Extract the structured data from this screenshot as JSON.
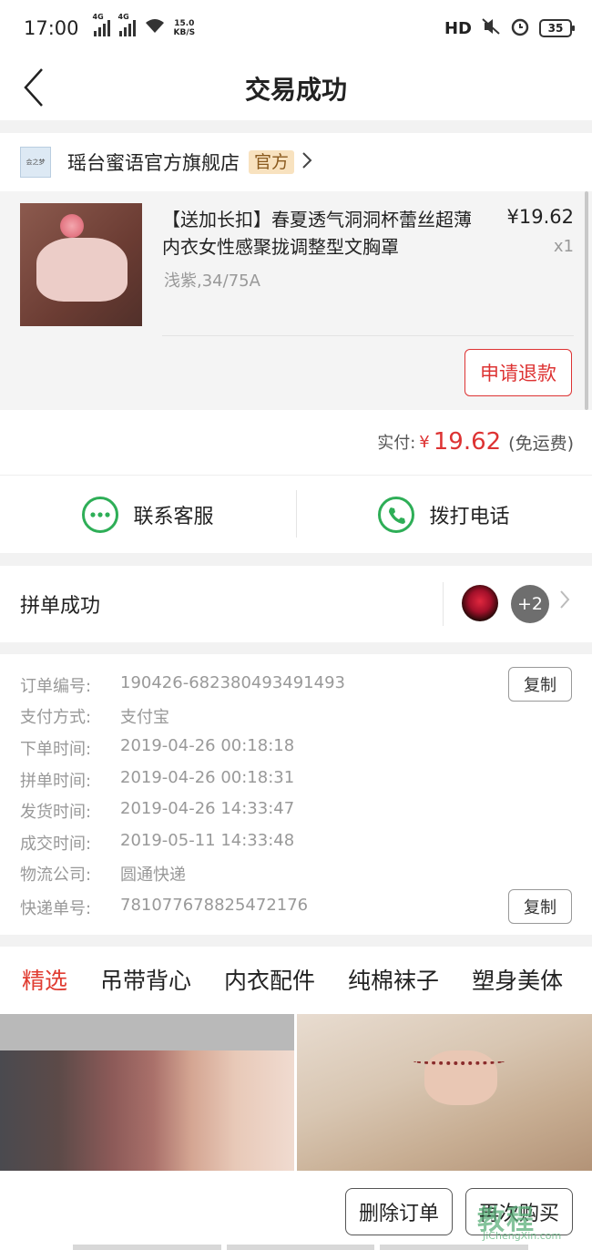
{
  "status_bar": {
    "time": "17:00",
    "net1": "4G",
    "net2": "4G",
    "speed_value": "15.0",
    "speed_unit": "KB/S",
    "hd": "HD",
    "battery": "35"
  },
  "nav": {
    "title": "交易成功"
  },
  "store": {
    "name": "瑶台蜜语官方旗舰店",
    "tag": "官方",
    "logo_text": "会之梦"
  },
  "product": {
    "title": "【送加长扣】春夏透气洞洞杯蕾丝超薄内衣女性感聚拢调整型文胸罩",
    "spec": "浅紫,34/75A",
    "price": "¥19.62",
    "qty": "x1",
    "refund_label": "申请退款"
  },
  "payment": {
    "label": "实付:",
    "yen": "¥",
    "amount": "19.62",
    "note": "(免运费)"
  },
  "contact": {
    "service_label": "联系客服",
    "phone_label": "拨打电话"
  },
  "group": {
    "label": "拼单成功",
    "more_count": "+2"
  },
  "order_info": {
    "copy_label": "复制",
    "rows": [
      {
        "k": "订单编号:",
        "v": "190426-682380493491493"
      },
      {
        "k": "支付方式:",
        "v": "支付宝"
      },
      {
        "k": "下单时间:",
        "v": "2019-04-26 00:18:18"
      },
      {
        "k": "拼单时间:",
        "v": "2019-04-26 00:18:31"
      },
      {
        "k": "发货时间:",
        "v": "2019-04-26 14:33:47"
      },
      {
        "k": "成交时间:",
        "v": "2019-05-11 14:33:48"
      },
      {
        "k": "物流公司:",
        "v": "圆通快递"
      },
      {
        "k": "快递单号:",
        "v": "781077678825472176"
      }
    ]
  },
  "tabs": [
    "精选",
    "吊带背心",
    "内衣配件",
    "纯棉袜子",
    "塑身美体"
  ],
  "bottom": {
    "delete_label": "删除订单",
    "rebuy_label": "再次购买"
  },
  "watermark": {
    "main": "教程",
    "sub": "JiChengXin.com"
  },
  "colors": {
    "accent_red": "#e03c31",
    "green": "#2eae57",
    "tag_bg": "#f8e2bf"
  }
}
